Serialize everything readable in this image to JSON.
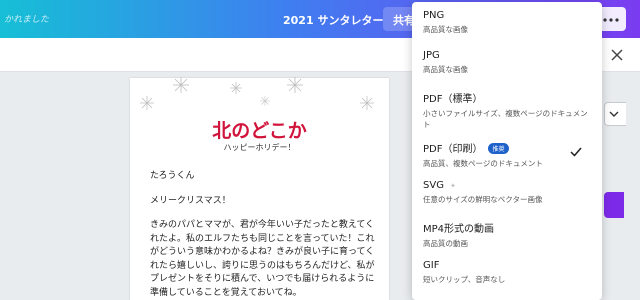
{
  "topbar": {
    "status_text": "かれました",
    "doc_title": "2021 サンタレター",
    "share_label": "共有"
  },
  "card": {
    "title": "北のどこか",
    "subtitle": "ハッピーホリデー！",
    "paragraphs": [
      "たろうくん",
      "メリークリスマス！",
      "きみのパパとママが、君が今年いい子だったと教えてくれたよ。私のエルフたちも同じことを言っていた！これがどういう意味かわかるよね？きみが良い子に育ってくれたら嬉しいし、誇りに思うのはもちろんだけど、私がプレゼントをそりに積んで、いつでも届けられるように準備していることを覚えておいてね。"
    ]
  },
  "dropdown": {
    "items": [
      {
        "name": "PNG",
        "desc": "高品質な画像"
      },
      {
        "name": "JPG",
        "desc": "高品質な画像"
      },
      {
        "name": "PDF（標準）",
        "desc": "小さいファイルサイズ、複数ページのドキュメント"
      },
      {
        "name": "PDF（印刷）",
        "badge": "推奨",
        "desc": "高品質、複数ページのドキュメント",
        "selected": true
      },
      {
        "name": "SVG",
        "desc": "任意のサイズの鮮明なベクター画像"
      },
      {
        "name": "MP4形式の動画",
        "desc": "高品質の動画"
      },
      {
        "name": "GIF",
        "desc": "短いクリップ、音声なし"
      }
    ]
  },
  "icons": {
    "more": "more-horizontal-icon",
    "close": "close-icon",
    "check": "check-icon",
    "chevron": "chevron-down-icon",
    "sparkle": "sparkle-icon",
    "snowflake": "snowflake-icon"
  },
  "colors": {
    "accent_purple": "#7d2ae8",
    "title_red": "#d1143b",
    "badge_blue": "#1e62c9"
  }
}
